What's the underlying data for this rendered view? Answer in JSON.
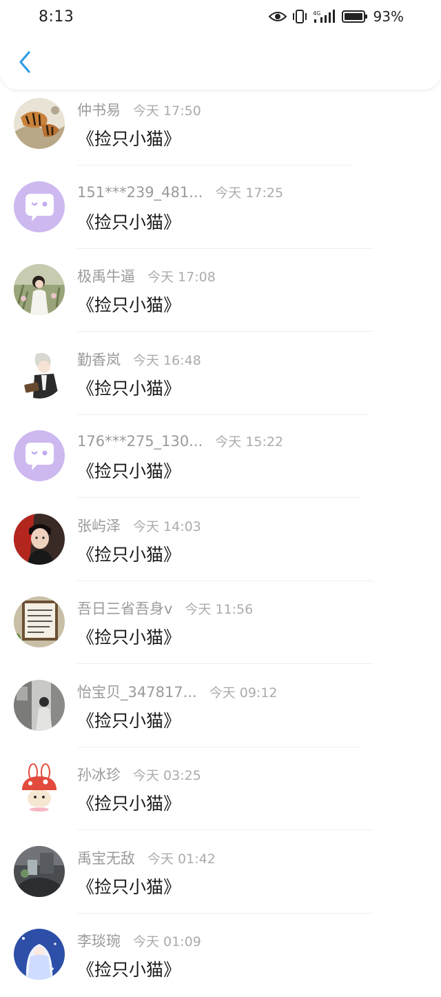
{
  "status_bar": {
    "time": "8:13",
    "battery_percent": "93%",
    "icons": [
      "eye-icon",
      "vibrate-icon",
      "signal-4g-icon",
      "battery-icon"
    ]
  },
  "nav": {
    "back_icon": "chevron-left-icon",
    "accent_color": "#2f9be6"
  },
  "messages": [
    {
      "name": "仲书易",
      "time": "今天 17:50",
      "text": "《捡只小猫》",
      "avatar": "tiger-painting"
    },
    {
      "name": "151***239_481...",
      "time": "今天 17:25",
      "text": "《捡只小猫》",
      "avatar": "default-chat"
    },
    {
      "name": "极禹牛逼",
      "time": "今天 17:08",
      "text": "《捡只小猫》",
      "avatar": "girl-photo"
    },
    {
      "name": "勤香岚",
      "time": "今天 16:48",
      "text": "《捡只小猫》",
      "avatar": "anime-boy"
    },
    {
      "name": "176***275_130...",
      "time": "今天 15:22",
      "text": "《捡只小猫》",
      "avatar": "default-chat"
    },
    {
      "name": "张屿泽",
      "time": "今天 14:03",
      "text": "《捡只小猫》",
      "avatar": "boy-photo"
    },
    {
      "name": "吾日三省吾身v",
      "time": "今天 11:56",
      "text": "《捡只小猫》",
      "avatar": "calligraphy-frame"
    },
    {
      "name": "怡宝贝_347817...",
      "time": "今天 09:12",
      "text": "《捡只小猫》",
      "avatar": "street-photo"
    },
    {
      "name": "孙冰珍",
      "time": "今天 03:25",
      "text": "《捡只小猫》",
      "avatar": "bunny-cartoon"
    },
    {
      "name": "禹宝无敌",
      "time": "今天 01:42",
      "text": "《捡只小猫》",
      "avatar": "car-photo"
    },
    {
      "name": "李琰琬",
      "time": "今天 01:09",
      "text": "《捡只小猫》",
      "avatar": "anime-girl"
    }
  ]
}
